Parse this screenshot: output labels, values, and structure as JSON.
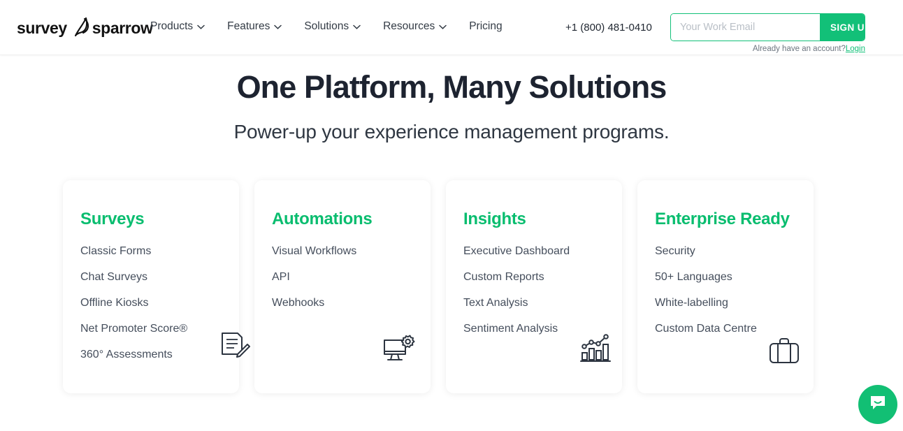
{
  "header": {
    "logo": {
      "text_left": "survey",
      "text_right": "sparrow",
      "mark": "sparrow-bird-mark"
    },
    "nav": [
      {
        "label": "Products",
        "has_chevron": true
      },
      {
        "label": "Features",
        "has_chevron": true
      },
      {
        "label": "Solutions",
        "has_chevron": true
      },
      {
        "label": "Resources",
        "has_chevron": true
      },
      {
        "label": "Pricing",
        "has_chevron": false
      }
    ],
    "phone": "+1 (800) 481-0410",
    "signup": {
      "placeholder": "Your Work Email",
      "value": "",
      "button_label": "SIGN UP",
      "account_prompt": "Already have an account?",
      "login_label": "Login"
    }
  },
  "hero": {
    "headline": "One Platform, Many Solutions",
    "subhead": "Power-up your experience management programs."
  },
  "cards": [
    {
      "title": "Surveys",
      "icon": "document-pencil-icon",
      "items": [
        "Classic Forms",
        "Chat Surveys",
        "Offline Kiosks",
        "Net Promoter Score®",
        "360° Assessments"
      ]
    },
    {
      "title": "Automations",
      "icon": "monitor-gear-icon",
      "items": [
        "Visual Workflows",
        "API",
        "Webhooks"
      ]
    },
    {
      "title": "Insights",
      "icon": "bar-chart-trend-icon",
      "items": [
        "Executive Dashboard",
        "Custom Reports",
        "Text Analysis",
        "Sentiment Analysis"
      ]
    },
    {
      "title": "Enterprise Ready",
      "icon": "briefcase-icon",
      "items": [
        "Security",
        "50+ Languages",
        "White-labelling",
        "Custom Data Centre"
      ]
    }
  ],
  "chat_widget": {
    "icon": "chat-bubble-smile-icon"
  },
  "colors": {
    "brand_green": "#12c078",
    "heading_green": "#09bd6f",
    "text_dark": "#1d2330",
    "text_body": "#454e5c",
    "muted": "#6d7680"
  }
}
